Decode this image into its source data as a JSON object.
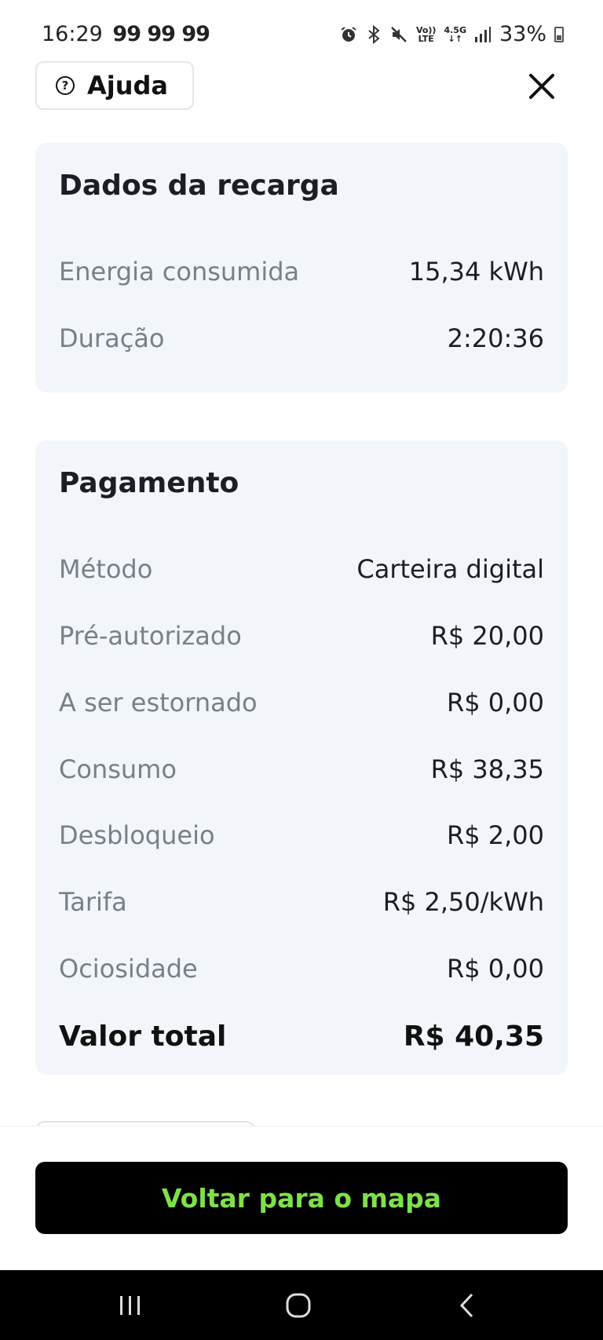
{
  "status_bar": {
    "time": "16:29",
    "notifications": "99 99 99",
    "network_top": "Vo))",
    "network_bottom": "LTE",
    "data_top": "4.5G",
    "data_bottom": "↓↑",
    "battery": "33%",
    "icons": [
      "alarm-icon",
      "bluetooth-icon",
      "mute-icon",
      "signal-icon",
      "battery-icon"
    ]
  },
  "header": {
    "help_label": "Ajuda",
    "help_icon": "question-circle-icon",
    "close_icon": "close-icon"
  },
  "recharge_card": {
    "title": "Dados da recarga",
    "rows": [
      {
        "label": "Energia consumida",
        "value": "15,34 kWh"
      },
      {
        "label": "Duração",
        "value": "2:20:36"
      }
    ]
  },
  "payment_card": {
    "title": "Pagamento",
    "rows": [
      {
        "label": "Método",
        "value": "Carteira digital"
      },
      {
        "label": "Pré-autorizado",
        "value": "R$ 20,00"
      },
      {
        "label": "A ser estornado",
        "value": "R$ 0,00"
      },
      {
        "label": "Consumo",
        "value": "R$ 38,35"
      },
      {
        "label": "Desbloqueio",
        "value": "R$ 2,00"
      },
      {
        "label": "Tarifa",
        "value": "R$ 2,50/kWh"
      },
      {
        "label": "Ociosidade",
        "value": "R$ 0,00"
      }
    ],
    "total_label": "Valor total",
    "total_value": "R$ 40,35"
  },
  "actions": {
    "back_to_map": "Voltar para o mapa"
  },
  "colors": {
    "card_bg": "#f2f5f9",
    "button_bg": "#000000",
    "button_text": "#7fe14a",
    "label_gray": "#7a7f87"
  },
  "nav_bar": {
    "icons": [
      "recent-apps-icon",
      "home-icon",
      "back-icon"
    ]
  }
}
